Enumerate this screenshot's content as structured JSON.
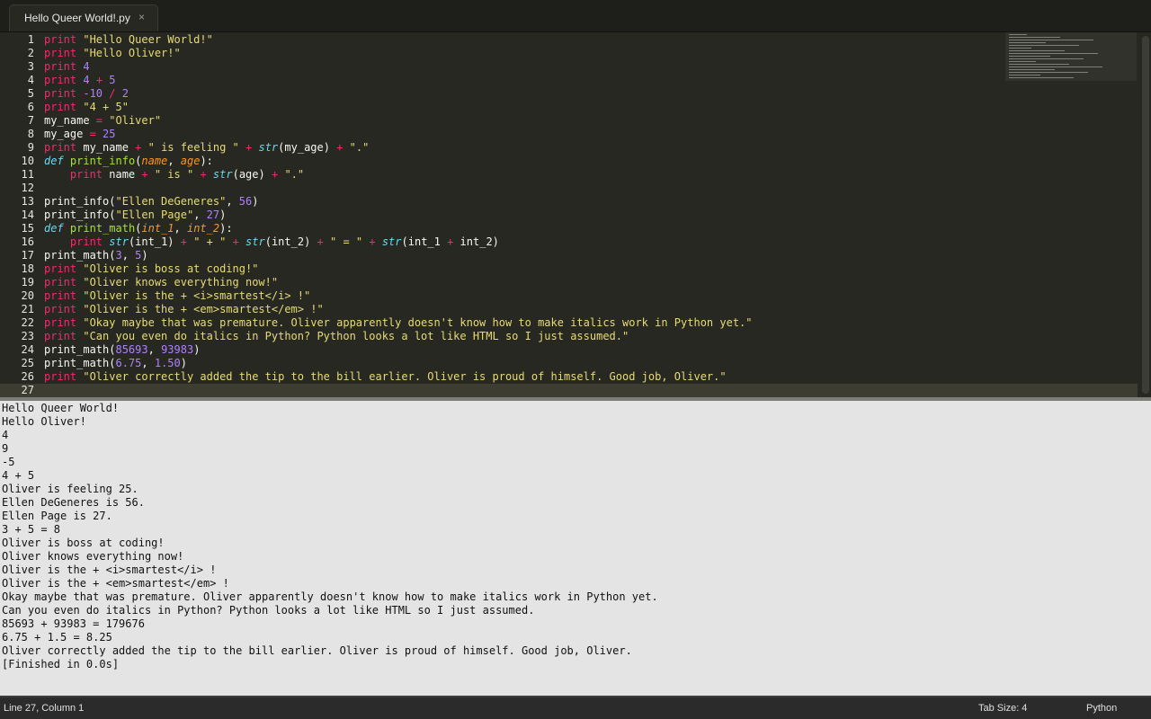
{
  "tab": {
    "title": "Hello Queer World!.py",
    "close": "×"
  },
  "gutter": [
    "1",
    "2",
    "3",
    "4",
    "5",
    "6",
    "7",
    "8",
    "9",
    "10",
    "11",
    "12",
    "13",
    "14",
    "15",
    "16",
    "17",
    "18",
    "19",
    "20",
    "21",
    "22",
    "23",
    "24",
    "25",
    "26",
    "27"
  ],
  "code_lines": [
    [
      [
        "print",
        "k"
      ],
      [
        " ",
        ""
      ],
      [
        "\"Hello Queer World!\"",
        "s"
      ]
    ],
    [
      [
        "print",
        "k"
      ],
      [
        " ",
        ""
      ],
      [
        "\"Hello Oliver!\"",
        "s"
      ]
    ],
    [
      [
        "print",
        "k"
      ],
      [
        " ",
        ""
      ],
      [
        "4",
        "n"
      ]
    ],
    [
      [
        "print",
        "k"
      ],
      [
        " ",
        ""
      ],
      [
        "4",
        "n"
      ],
      [
        " ",
        ""
      ],
      [
        "+",
        "k"
      ],
      [
        " ",
        ""
      ],
      [
        "5",
        "n"
      ]
    ],
    [
      [
        "print",
        "k"
      ],
      [
        " ",
        ""
      ],
      [
        "-10",
        "n"
      ],
      [
        " ",
        ""
      ],
      [
        "/",
        "k"
      ],
      [
        " ",
        ""
      ],
      [
        "2",
        "n"
      ]
    ],
    [
      [
        "print",
        "k"
      ],
      [
        " ",
        ""
      ],
      [
        "\"4 + 5\"",
        "s"
      ]
    ],
    [
      [
        "my_name ",
        ""
      ],
      [
        "=",
        "k"
      ],
      [
        " ",
        ""
      ],
      [
        "\"Oliver\"",
        "s"
      ]
    ],
    [
      [
        "my_age ",
        ""
      ],
      [
        "=",
        "k"
      ],
      [
        " ",
        ""
      ],
      [
        "25",
        "n"
      ]
    ],
    [
      [
        "print",
        "k"
      ],
      [
        " my_name ",
        ""
      ],
      [
        "+",
        "k"
      ],
      [
        " ",
        ""
      ],
      [
        "\" is feeling \"",
        "s"
      ],
      [
        " ",
        ""
      ],
      [
        "+",
        "k"
      ],
      [
        " ",
        ""
      ],
      [
        "str",
        "b"
      ],
      [
        "(my_age) ",
        ""
      ],
      [
        "+",
        "k"
      ],
      [
        " ",
        ""
      ],
      [
        "\".\"",
        "s"
      ]
    ],
    [
      [
        "def",
        "d"
      ],
      [
        " ",
        ""
      ],
      [
        "print_info",
        "f"
      ],
      [
        "(",
        ""
      ],
      [
        "name",
        "p"
      ],
      [
        ", ",
        ""
      ],
      [
        "age",
        "p"
      ],
      [
        "):",
        ""
      ]
    ],
    [
      [
        "    ",
        ""
      ],
      [
        "print",
        "k"
      ],
      [
        " name ",
        ""
      ],
      [
        "+",
        "k"
      ],
      [
        " ",
        ""
      ],
      [
        "\" is \"",
        "s"
      ],
      [
        " ",
        ""
      ],
      [
        "+",
        "k"
      ],
      [
        " ",
        ""
      ],
      [
        "str",
        "b"
      ],
      [
        "(age) ",
        ""
      ],
      [
        "+",
        "k"
      ],
      [
        " ",
        ""
      ],
      [
        "\".\"",
        "s"
      ]
    ],
    [],
    [
      [
        "print_info(",
        ""
      ],
      [
        "\"Ellen DeGeneres\"",
        "s"
      ],
      [
        ", ",
        ""
      ],
      [
        "56",
        "n"
      ],
      [
        ")",
        ""
      ]
    ],
    [
      [
        "print_info(",
        ""
      ],
      [
        "\"Ellen Page\"",
        "s"
      ],
      [
        ", ",
        ""
      ],
      [
        "27",
        "n"
      ],
      [
        ")",
        ""
      ]
    ],
    [
      [
        "def",
        "d"
      ],
      [
        " ",
        ""
      ],
      [
        "print_math",
        "f"
      ],
      [
        "(",
        ""
      ],
      [
        "int_1",
        "p"
      ],
      [
        ", ",
        ""
      ],
      [
        "int_2",
        "p"
      ],
      [
        "):",
        ""
      ]
    ],
    [
      [
        "    ",
        ""
      ],
      [
        "print",
        "k"
      ],
      [
        " ",
        ""
      ],
      [
        "str",
        "b"
      ],
      [
        "(int_1) ",
        ""
      ],
      [
        "+",
        "k"
      ],
      [
        " ",
        ""
      ],
      [
        "\" + \"",
        "s"
      ],
      [
        " ",
        ""
      ],
      [
        "+",
        "k"
      ],
      [
        " ",
        ""
      ],
      [
        "str",
        "b"
      ],
      [
        "(int_2) ",
        ""
      ],
      [
        "+",
        "k"
      ],
      [
        " ",
        ""
      ],
      [
        "\" = \"",
        "s"
      ],
      [
        " ",
        ""
      ],
      [
        "+",
        "k"
      ],
      [
        " ",
        ""
      ],
      [
        "str",
        "b"
      ],
      [
        "(int_1 ",
        ""
      ],
      [
        "+",
        "k"
      ],
      [
        " int_2)",
        ""
      ]
    ],
    [
      [
        "print_math(",
        ""
      ],
      [
        "3",
        "n"
      ],
      [
        ", ",
        ""
      ],
      [
        "5",
        "n"
      ],
      [
        ")",
        ""
      ]
    ],
    [
      [
        "print",
        "k"
      ],
      [
        " ",
        ""
      ],
      [
        "\"Oliver is boss at coding!\"",
        "s"
      ]
    ],
    [
      [
        "print",
        "k"
      ],
      [
        " ",
        ""
      ],
      [
        "\"Oliver knows everything now!\"",
        "s"
      ]
    ],
    [
      [
        "print",
        "k"
      ],
      [
        " ",
        ""
      ],
      [
        "\"Oliver is the + <i>smartest</i> !\"",
        "s"
      ]
    ],
    [
      [
        "print",
        "k"
      ],
      [
        " ",
        ""
      ],
      [
        "\"Oliver is the + <em>smartest</em> !\"",
        "s"
      ]
    ],
    [
      [
        "print",
        "k"
      ],
      [
        " ",
        ""
      ],
      [
        "\"Okay maybe that was premature. Oliver apparently doesn't know how to make italics work in Python yet.\"",
        "s"
      ]
    ],
    [
      [
        "print",
        "k"
      ],
      [
        " ",
        ""
      ],
      [
        "\"Can you even do italics in Python? Python looks a lot like HTML so I just assumed.\"",
        "s"
      ]
    ],
    [
      [
        "print_math(",
        ""
      ],
      [
        "85693",
        "n"
      ],
      [
        ", ",
        ""
      ],
      [
        "93983",
        "n"
      ],
      [
        ")",
        ""
      ]
    ],
    [
      [
        "print_math(",
        ""
      ],
      [
        "6.75",
        "n"
      ],
      [
        ", ",
        ""
      ],
      [
        "1.50",
        "n"
      ],
      [
        ")",
        ""
      ]
    ],
    [
      [
        "print",
        "k"
      ],
      [
        " ",
        ""
      ],
      [
        "\"Oliver correctly added the tip to the bill earlier. Oliver is proud of himself. Good job, Oliver.\"",
        "s"
      ]
    ],
    []
  ],
  "output_lines": [
    "Hello Queer World!",
    "Hello Oliver!",
    "4",
    "9",
    "-5",
    "4 + 5",
    "Oliver is feeling 25.",
    "Ellen DeGeneres is 56.",
    "Ellen Page is 27.",
    "3 + 5 = 8",
    "Oliver is boss at coding!",
    "Oliver knows everything now!",
    "Oliver is the + <i>smartest</i> !",
    "Oliver is the + <em>smartest</em> !",
    "Okay maybe that was premature. Oliver apparently doesn't know how to make italics work in Python yet.",
    "Can you even do italics in Python? Python looks a lot like HTML so I just assumed.",
    "85693 + 93983 = 179676",
    "6.75 + 1.5 = 8.25",
    "Oliver correctly added the tip to the bill earlier. Oliver is proud of himself. Good job, Oliver.",
    "[Finished in 0.0s]"
  ],
  "status": {
    "position": "Line 27, Column 1",
    "tab_size": "Tab Size: 4",
    "syntax": "Python"
  },
  "colors": {
    "keyword": "#f92672",
    "string": "#e6db74",
    "number": "#ae81ff",
    "function": "#a6e22e",
    "parameter": "#fd971f",
    "builtin": "#66d9ef",
    "background": "#272822"
  }
}
